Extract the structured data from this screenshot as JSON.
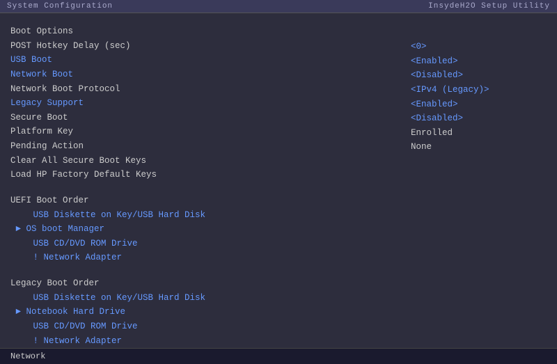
{
  "header": {
    "left_label": "System Configuration",
    "right_label": "InsydeH2O Setup Utility"
  },
  "menu": {
    "items": [
      {
        "label": "Boot Options",
        "type": "section-header",
        "highlighted": false
      },
      {
        "label": "POST Hotkey Delay (sec)",
        "type": "normal",
        "highlighted": false
      },
      {
        "label": "USB Boot",
        "type": "normal",
        "highlighted": true
      },
      {
        "label": "Network Boot",
        "type": "normal",
        "highlighted": true
      },
      {
        "label": "Network Boot Protocol",
        "type": "normal",
        "highlighted": false
      },
      {
        "label": "Legacy Support",
        "type": "normal",
        "highlighted": true
      },
      {
        "label": "Secure Boot",
        "type": "normal",
        "highlighted": false
      },
      {
        "label": "Platform Key",
        "type": "normal",
        "highlighted": false
      },
      {
        "label": "Pending Action",
        "type": "normal",
        "highlighted": false
      },
      {
        "label": "Clear All Secure Boot Keys",
        "type": "normal",
        "highlighted": false
      },
      {
        "label": "Load HP Factory Default Keys",
        "type": "normal",
        "highlighted": false
      },
      {
        "label": "",
        "type": "spacer"
      },
      {
        "label": "UEFI Boot Order",
        "type": "section-header",
        "highlighted": false
      },
      {
        "label": "   USB Diskette on Key/USB Hard Disk",
        "type": "indent-blue",
        "highlighted": true
      },
      {
        "label": " ► OS boot Manager",
        "type": "indent-arrow",
        "highlighted": true
      },
      {
        "label": "   USB CD/DVD ROM Drive",
        "type": "indent-blue",
        "highlighted": true
      },
      {
        "label": "   ! Network Adapter",
        "type": "indent-blue",
        "highlighted": true
      },
      {
        "label": "",
        "type": "spacer"
      },
      {
        "label": "Legacy Boot Order",
        "type": "section-header",
        "highlighted": false
      },
      {
        "label": "   USB Diskette on Key/USB Hard Disk",
        "type": "indent-blue",
        "highlighted": true
      },
      {
        "label": " ► Notebook Hard Drive",
        "type": "indent-arrow",
        "highlighted": true
      },
      {
        "label": "   USB CD/DVD ROM Drive",
        "type": "indent-blue",
        "highlighted": true
      },
      {
        "label": "   ! Network Adapter",
        "type": "indent-blue",
        "highlighted": true
      }
    ]
  },
  "right_values": [
    {
      "label": "<0>",
      "type": "blue"
    },
    {
      "label": "<Enabled>",
      "type": "blue"
    },
    {
      "label": "<Disabled>",
      "type": "blue"
    },
    {
      "label": "<IPv4 (Legacy)>",
      "type": "blue"
    },
    {
      "label": "<Enabled>",
      "type": "blue"
    },
    {
      "label": "<Disabled>",
      "type": "blue"
    },
    {
      "label": "Enrolled",
      "type": "normal"
    },
    {
      "label": "None",
      "type": "normal"
    }
  ],
  "footer": {
    "network_label": "Network"
  }
}
